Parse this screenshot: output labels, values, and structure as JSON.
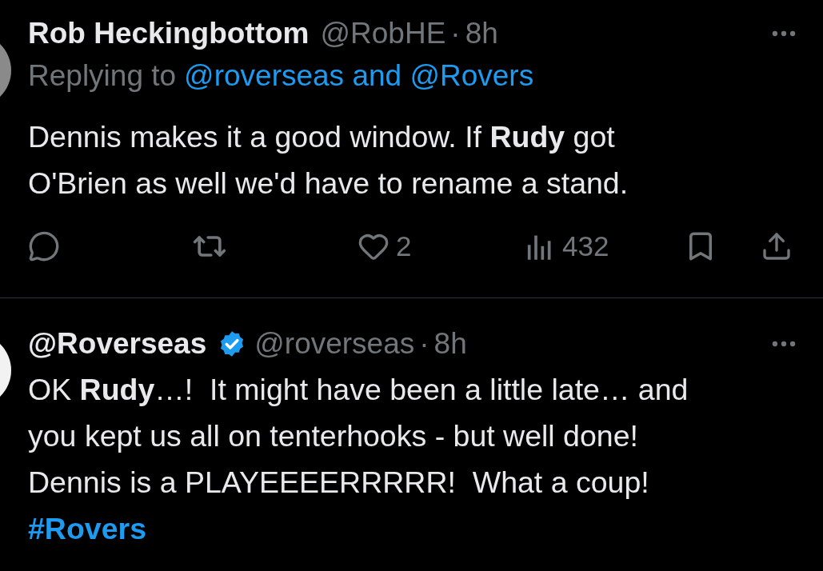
{
  "tweets": [
    {
      "name": "Rob Heckingbottom",
      "verified": false,
      "handle": "@RobHE",
      "separator": "·",
      "time": "8h",
      "replying_label": "Replying to",
      "replying_to": "@roverseas and @Rovers",
      "body": "Dennis makes it a good window. If **Rudy** got\nO'Brien as well we'd have to rename a stand.",
      "actions": {
        "likes": "2",
        "views": "432"
      }
    },
    {
      "name": "@Roverseas",
      "verified": true,
      "handle": "@roverseas",
      "separator": "·",
      "time": "8h",
      "body": "OK **Rudy**…!  It might have been a little late… and\nyou kept us all on tenterhooks - but well done!\nDennis is a PLAYEEEERRRRR!  What a coup!",
      "hashtag": "#Rovers"
    }
  ]
}
